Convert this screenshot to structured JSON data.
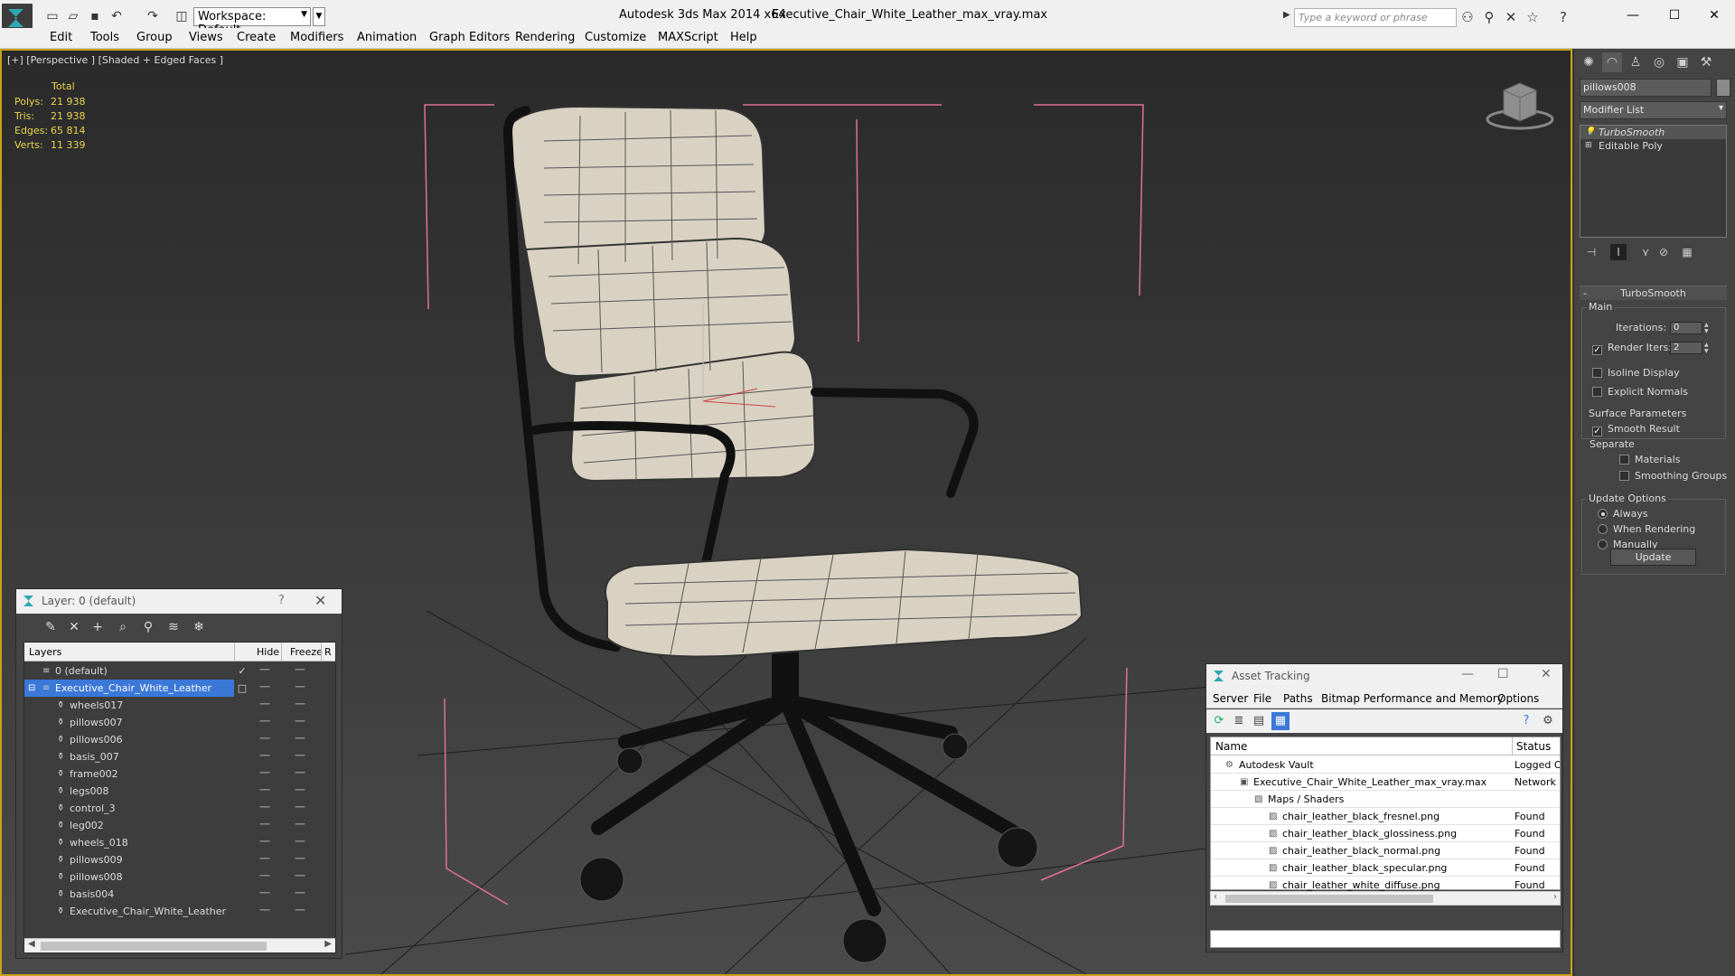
{
  "titlebar": {
    "workspace_label": "Workspace: Default",
    "app_title": "Autodesk 3ds Max  2014 x64",
    "doc_title": "Executive_Chair_White_Leather_max_vray.max",
    "search_placeholder": "Type a keyword or phrase"
  },
  "menu": [
    "Edit",
    "Tools",
    "Group",
    "Views",
    "Create",
    "Modifiers",
    "Animation",
    "Graph Editors",
    "Rendering",
    "Customize",
    "MAXScript",
    "Help"
  ],
  "viewport": {
    "label": "[+] [Perspective ] [Shaded + Edged Faces ]",
    "stats_header": "Total",
    "stats": [
      {
        "key": "Polys:",
        "value": "21 938"
      },
      {
        "key": "Tris:",
        "value": "21 938"
      },
      {
        "key": "Edges:",
        "value": "65 814"
      },
      {
        "key": "Verts:",
        "value": "11 339"
      }
    ]
  },
  "command_panel": {
    "object_name": "pillows008",
    "modifier_list": "Modifier List",
    "stack": [
      "TurboSmooth",
      "Editable Poly"
    ],
    "rollout_title": "TurboSmooth",
    "main_group": "Main",
    "iterations_label": "Iterations:",
    "iterations_value": "0",
    "render_iters_label": "Render Iters:",
    "render_iters_value": "2",
    "isoline_label": "Isoline Display",
    "explicit_normals_label": "Explicit Normals",
    "surface_group": "Surface Parameters",
    "smooth_result_label": "Smooth Result",
    "separate_label": "Separate",
    "materials_label": "Materials",
    "smoothing_groups_label": "Smoothing Groups",
    "update_group": "Update Options",
    "always_label": "Always",
    "when_rendering_label": "When Rendering",
    "manually_label": "Manually",
    "update_button": "Update"
  },
  "layer_dialog": {
    "title": "Layer: 0 (default)",
    "help": "?",
    "col_layers": "Layers",
    "col_hide": "Hide",
    "col_freeze": "Freeze",
    "col_r": "R",
    "rows": [
      {
        "name": "0 (default)",
        "level": 0,
        "selected": false,
        "mark": "✓"
      },
      {
        "name": "Executive_Chair_White_Leather",
        "level": 0,
        "selected": true,
        "mark": "□"
      },
      {
        "name": "wheels017",
        "level": 1,
        "selected": false,
        "mark": ""
      },
      {
        "name": "pillows007",
        "level": 1,
        "selected": false,
        "mark": ""
      },
      {
        "name": "pillows006",
        "level": 1,
        "selected": false,
        "mark": ""
      },
      {
        "name": "basis_007",
        "level": 1,
        "selected": false,
        "mark": ""
      },
      {
        "name": "frame002",
        "level": 1,
        "selected": false,
        "mark": ""
      },
      {
        "name": "legs008",
        "level": 1,
        "selected": false,
        "mark": ""
      },
      {
        "name": "control_3",
        "level": 1,
        "selected": false,
        "mark": ""
      },
      {
        "name": "leg002",
        "level": 1,
        "selected": false,
        "mark": ""
      },
      {
        "name": "wheels_018",
        "level": 1,
        "selected": false,
        "mark": ""
      },
      {
        "name": "pillows009",
        "level": 1,
        "selected": false,
        "mark": ""
      },
      {
        "name": "pillows008",
        "level": 1,
        "selected": false,
        "mark": ""
      },
      {
        "name": "basis004",
        "level": 1,
        "selected": false,
        "mark": ""
      },
      {
        "name": "Executive_Chair_White_Leather",
        "level": 1,
        "selected": false,
        "mark": ""
      }
    ]
  },
  "asset_dialog": {
    "title": "Asset Tracking",
    "menu": [
      "Server",
      "File",
      "Paths",
      "Bitmap Performance and Memory",
      "Options"
    ],
    "col_name": "Name",
    "col_status": "Status",
    "rows": [
      {
        "name": "Autodesk Vault",
        "status": "Logged O",
        "level": 0
      },
      {
        "name": "Executive_Chair_White_Leather_max_vray.max",
        "status": "Network",
        "level": 1
      },
      {
        "name": "Maps / Shaders",
        "status": "",
        "level": 2
      },
      {
        "name": "chair_leather_black_fresnel.png",
        "status": "Found",
        "level": 3
      },
      {
        "name": "chair_leather_black_glossiness.png",
        "status": "Found",
        "level": 3
      },
      {
        "name": "chair_leather_black_normal.png",
        "status": "Found",
        "level": 3
      },
      {
        "name": "chair_leather_black_specular.png",
        "status": "Found",
        "level": 3
      },
      {
        "name": "chair_leather_white_diffuse.png",
        "status": "Found",
        "level": 3
      }
    ]
  },
  "colors": {
    "viewport_border": "#c7a21a",
    "stats": "#e8d44d",
    "selection": "#3b78d8",
    "bbox": "#e0709a"
  }
}
